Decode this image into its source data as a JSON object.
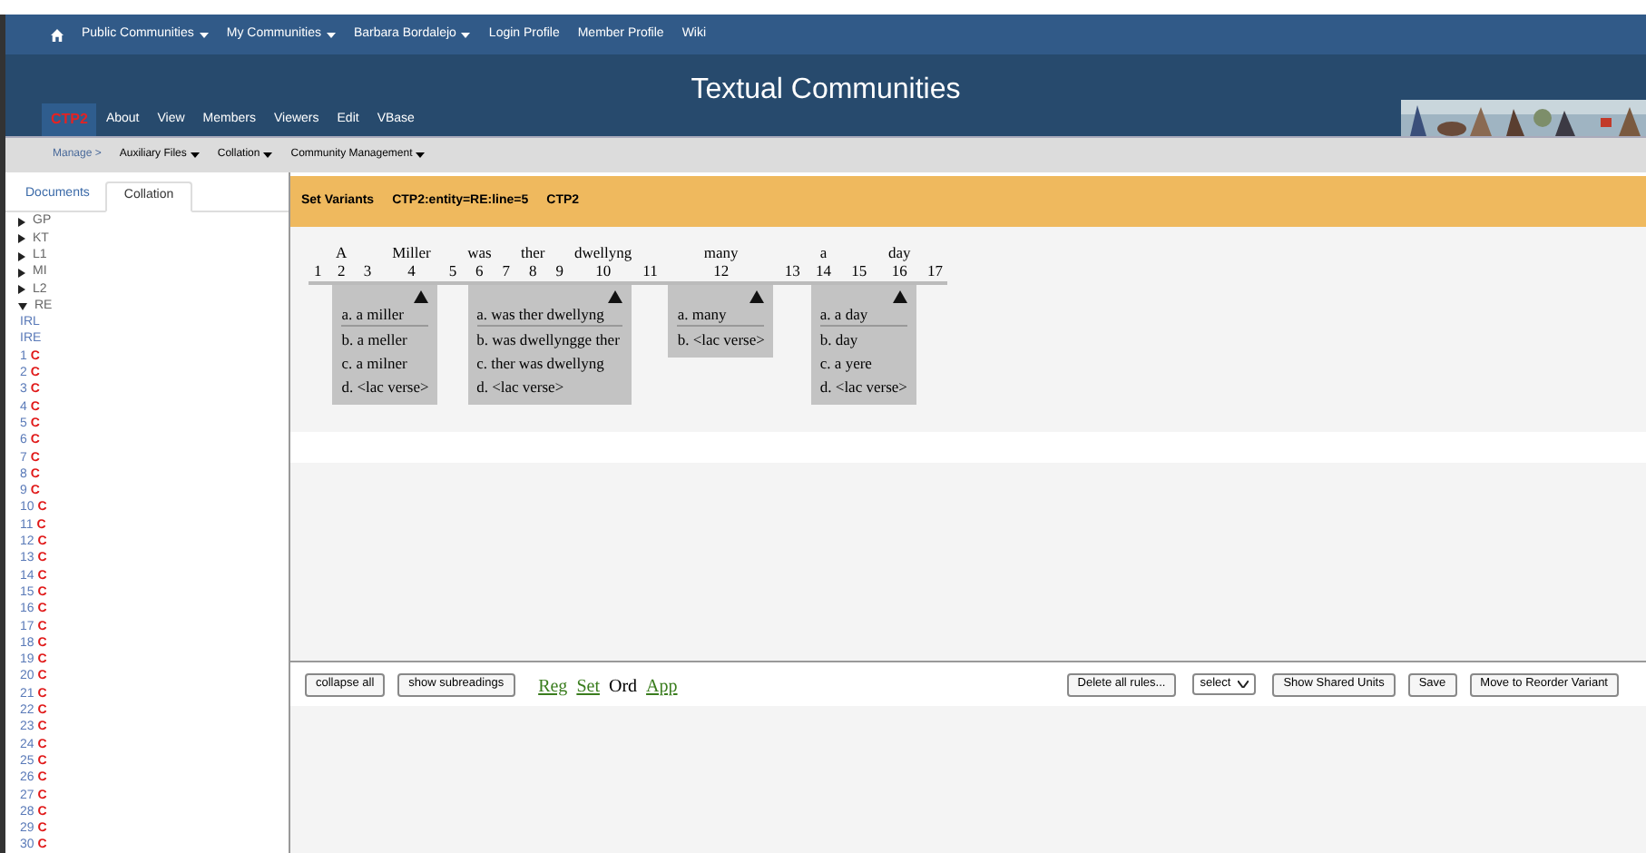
{
  "top_nav": [
    {
      "label": "Public Communities",
      "dropdown": true
    },
    {
      "label": "My Communities",
      "dropdown": true
    },
    {
      "label": "Barbara Bordalejo",
      "dropdown": true
    },
    {
      "label": "Login Profile",
      "dropdown": false
    },
    {
      "label": "Member Profile",
      "dropdown": false
    },
    {
      "label": "Wiki",
      "dropdown": false
    }
  ],
  "site_title": "Textual Communities",
  "community": {
    "name": "CTP2",
    "links": [
      "About",
      "View",
      "Members",
      "Viewers",
      "Edit",
      "VBase"
    ]
  },
  "sub_nav": {
    "lead": "Manage >",
    "menus": [
      "Auxiliary Files",
      "Collation",
      "Community Management"
    ]
  },
  "sidebar": {
    "tabs": [
      {
        "label": "Documents",
        "selected": false
      },
      {
        "label": "Collation",
        "selected": true
      }
    ],
    "tree": [
      {
        "label": "GP",
        "expanded": false
      },
      {
        "label": "KT",
        "expanded": false
      },
      {
        "label": "L1",
        "expanded": false
      },
      {
        "label": "MI",
        "expanded": false
      },
      {
        "label": "L2",
        "expanded": false
      },
      {
        "label": "RE",
        "expanded": true,
        "children": [
          {
            "label": "IRL"
          },
          {
            "label": "IRE"
          },
          {
            "label": "1",
            "mark": "C"
          },
          {
            "label": "2",
            "mark": "C"
          },
          {
            "label": "3",
            "mark": "C"
          },
          {
            "label": "4",
            "mark": "C"
          },
          {
            "label": "5",
            "mark": "C"
          },
          {
            "label": "6",
            "mark": "C"
          },
          {
            "label": "7",
            "mark": "C"
          },
          {
            "label": "8",
            "mark": "C"
          },
          {
            "label": "9",
            "mark": "C"
          },
          {
            "label": "10",
            "mark": "C"
          },
          {
            "label": "11",
            "mark": "C"
          },
          {
            "label": "12",
            "mark": "C"
          },
          {
            "label": "13",
            "mark": "C"
          },
          {
            "label": "14",
            "mark": "C"
          },
          {
            "label": "15",
            "mark": "C"
          },
          {
            "label": "16",
            "mark": "C"
          },
          {
            "label": "17",
            "mark": "C"
          },
          {
            "label": "18",
            "mark": "C"
          },
          {
            "label": "19",
            "mark": "C"
          },
          {
            "label": "20",
            "mark": "C"
          },
          {
            "label": "21",
            "mark": "C"
          },
          {
            "label": "22",
            "mark": "C"
          },
          {
            "label": "23",
            "mark": "C"
          },
          {
            "label": "24",
            "mark": "C"
          },
          {
            "label": "25",
            "mark": "C"
          },
          {
            "label": "26",
            "mark": "C"
          },
          {
            "label": "27",
            "mark": "C"
          },
          {
            "label": "28",
            "mark": "C"
          },
          {
            "label": "29",
            "mark": "C"
          },
          {
            "label": "30",
            "mark": "C"
          }
        ]
      }
    ]
  },
  "panel": {
    "title": "Set Variants",
    "entity": "CTP2:entity=RE:line=5",
    "community": "CTP2",
    "segments": [
      {
        "positions": [
          {
            "number": "1"
          }
        ]
      },
      {
        "positions": [
          {
            "number": "2",
            "word": "A"
          },
          {
            "number": "3"
          },
          {
            "number": "4",
            "word": "Miller"
          }
        ],
        "readings": [
          "a. a miller",
          "b. a meller",
          "c. a milner",
          "d. <lac verse>"
        ]
      },
      {
        "positions": [
          {
            "number": "5"
          }
        ]
      },
      {
        "positions": [
          {
            "number": "6",
            "word": "was"
          },
          {
            "number": "7"
          },
          {
            "number": "8",
            "word": "ther"
          },
          {
            "number": "9"
          },
          {
            "number": "10",
            "word": "dwellyng"
          }
        ],
        "readings": [
          "a. was ther dwellyng",
          "b. was dwellyngge ther",
          "c. ther was dwellyng",
          "d. <lac verse>"
        ]
      },
      {
        "positions": [
          {
            "number": "11"
          }
        ]
      },
      {
        "positions": [
          {
            "number": "12",
            "word": "many"
          }
        ],
        "readings": [
          "a. many",
          "b. <lac verse>"
        ]
      },
      {
        "positions": [
          {
            "number": "13"
          }
        ]
      },
      {
        "positions": [
          {
            "number": "14",
            "word": "a"
          },
          {
            "number": "15"
          },
          {
            "number": "16",
            "word": "day"
          }
        ],
        "readings": [
          "a. a day",
          "b. day",
          "c. a yere",
          "d. <lac verse>"
        ]
      },
      {
        "positions": [
          {
            "number": "17"
          }
        ]
      }
    ]
  },
  "toolbar": {
    "left_buttons": [
      "collapse all",
      "show subreadings"
    ],
    "modes": [
      {
        "label": "Reg",
        "selected": false
      },
      {
        "label": "Set",
        "selected": false
      },
      {
        "label": "Ord",
        "selected": true
      },
      {
        "label": "App",
        "selected": false
      }
    ],
    "delete_button": "Delete all rules...",
    "select": "select",
    "right_buttons": [
      "Show Shared Units",
      "Save",
      "Move to Reorder Variant"
    ]
  }
}
